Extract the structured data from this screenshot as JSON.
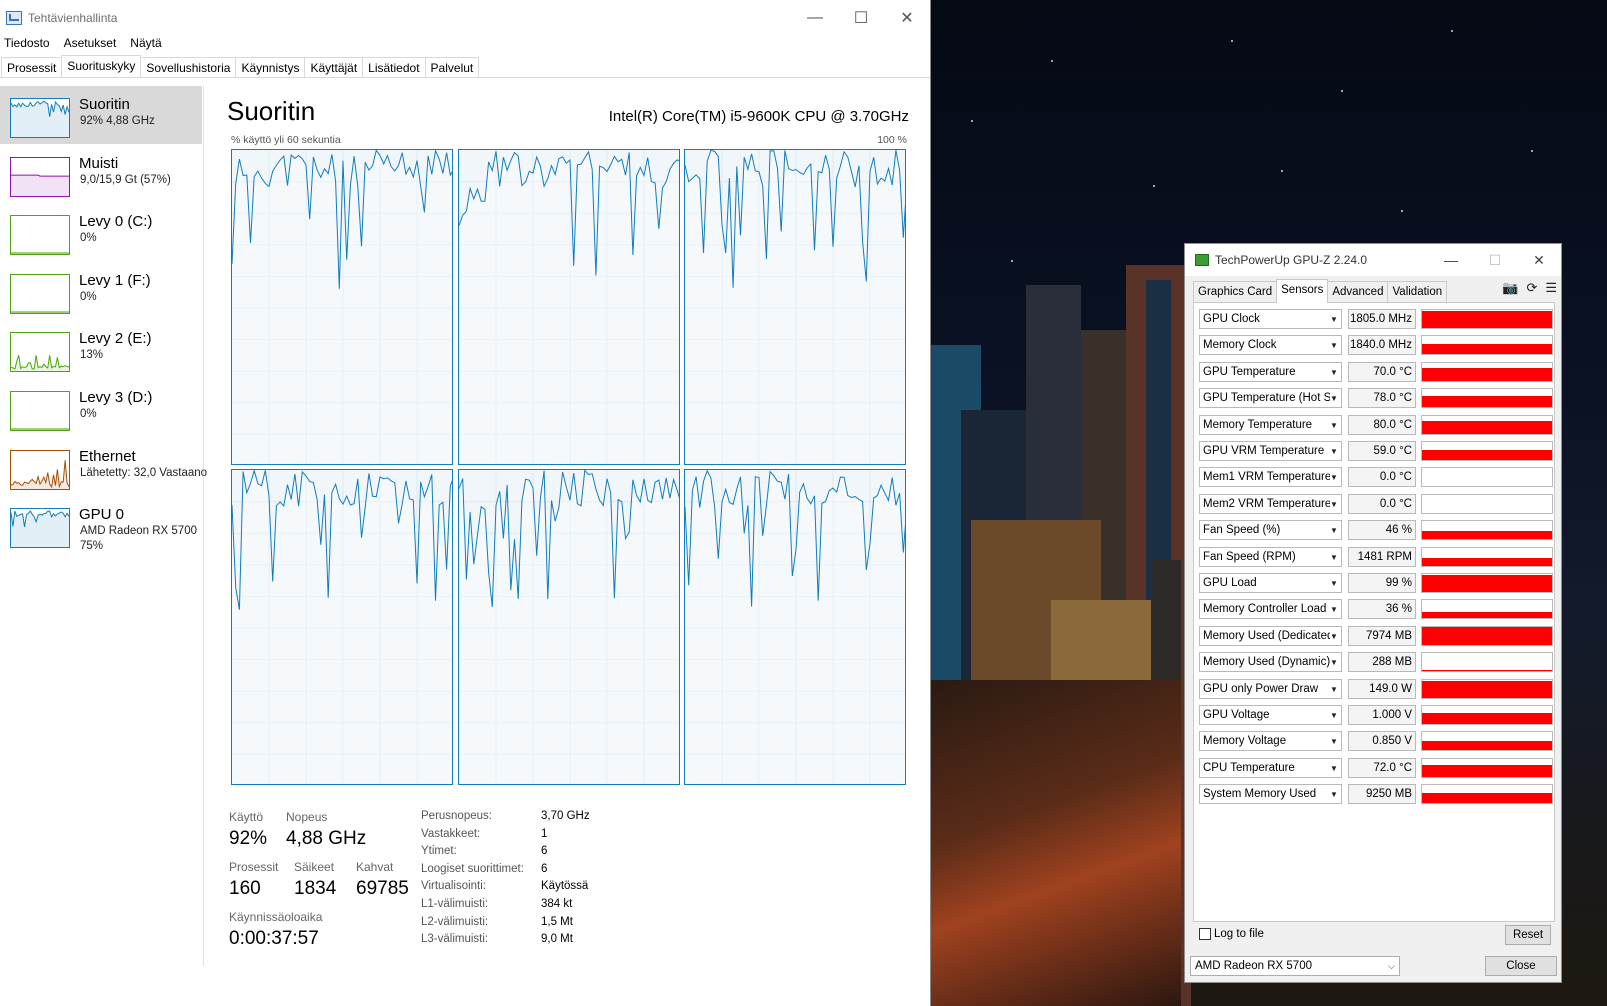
{
  "task_manager": {
    "title": "Tehtävienhallinta",
    "menu": [
      "Tiedosto",
      "Asetukset",
      "Näytä"
    ],
    "tabs": [
      "Prosessit",
      "Suorituskyky",
      "Sovellushistoria",
      "Käynnistys",
      "Käyttäjät",
      "Lisätiedot",
      "Palvelut"
    ],
    "active_tab": "Suorituskyky",
    "sidebar": [
      {
        "name": "Suoritin",
        "sub": "92% 4,88 GHz",
        "sub2": "",
        "color": "#117dbb"
      },
      {
        "name": "Muisti",
        "sub": "9,0/15,9 Gt (57%)",
        "sub2": "",
        "color": "#8b12ae"
      },
      {
        "name": "Levy 0 (C:)",
        "sub": "0%",
        "sub2": "",
        "color": "#4da60c"
      },
      {
        "name": "Levy 1 (F:)",
        "sub": "0%",
        "sub2": "",
        "color": "#4da60c"
      },
      {
        "name": "Levy 2 (E:)",
        "sub": "13%",
        "sub2": "",
        "color": "#4da60c"
      },
      {
        "name": "Levy 3 (D:)",
        "sub": "0%",
        "sub2": "",
        "color": "#4da60c"
      },
      {
        "name": "Ethernet",
        "sub": "Lähetetty: 32,0 Vastaano",
        "sub2": "",
        "color": "#a74f01"
      },
      {
        "name": "GPU 0",
        "sub": "AMD Radeon RX 5700",
        "sub2": "75%",
        "color": "#117dbb"
      }
    ],
    "main": {
      "title": "Suoritin",
      "cpu_model": "Intel(R) Core(TM) i5-9600K CPU @ 3.70GHz",
      "graph_caption": "% käyttö yli 60 sekuntia",
      "graph_max": "100 %",
      "stats": {
        "usage_label": "Käyttö",
        "usage": "92%",
        "speed_label": "Nopeus",
        "speed": "4,88 GHz",
        "processes_label": "Prosessit",
        "processes": "160",
        "threads_label": "Säikeet",
        "threads": "1834",
        "handles_label": "Kahvat",
        "handles": "69785",
        "uptime_label": "Käynnissäoloaika",
        "uptime": "0:00:37:57"
      },
      "properties": [
        {
          "label": "Perusnopeus:",
          "value": "3,70 GHz"
        },
        {
          "label": "Vastakkeet:",
          "value": "1"
        },
        {
          "label": "Ytimet:",
          "value": "6"
        },
        {
          "label": "Loogiset suorittimet:",
          "value": "6"
        },
        {
          "label": "Virtualisointi:",
          "value": "Käytössä"
        },
        {
          "label": "L1-välimuisti:",
          "value": "384 kt"
        },
        {
          "label": "L2-välimuisti:",
          "value": "1,5 Mt"
        },
        {
          "label": "L3-välimuisti:",
          "value": "9,0 Mt"
        }
      ]
    }
  },
  "gpuz": {
    "title": "TechPowerUp GPU-Z 2.24.0",
    "tabs": [
      "Graphics Card",
      "Sensors",
      "Advanced",
      "Validation"
    ],
    "active_tab": "Sensors",
    "sensors": [
      {
        "name": "GPU Clock",
        "value": "1805.0 MHz",
        "level": 0.95
      },
      {
        "name": "Memory Clock",
        "value": "1840.0 MHz",
        "level": 0.6
      },
      {
        "name": "GPU Temperature",
        "value": "70.0 °C",
        "level": 0.7
      },
      {
        "name": "GPU Temperature (Hot Spot)",
        "value": "78.0 °C",
        "level": 0.6
      },
      {
        "name": "Memory Temperature",
        "value": "80.0 °C",
        "level": 0.7
      },
      {
        "name": "GPU VRM Temperature",
        "value": "59.0 °C",
        "level": 0.55
      },
      {
        "name": "Mem1 VRM Temperature",
        "value": "0.0 °C",
        "level": 0.0
      },
      {
        "name": "Mem2 VRM Temperature",
        "value": "0.0 °C",
        "level": 0.0
      },
      {
        "name": "Fan Speed (%)",
        "value": "46 %",
        "level": 0.45
      },
      {
        "name": "Fan Speed (RPM)",
        "value": "1481 RPM",
        "level": 0.45
      },
      {
        "name": "GPU Load",
        "value": "99 %",
        "level": 0.95
      },
      {
        "name": "Memory Controller Load",
        "value": "36 %",
        "level": 0.35
      },
      {
        "name": "Memory Used (Dedicated)",
        "value": "7974 MB",
        "level": 0.97
      },
      {
        "name": "Memory Used (Dynamic)",
        "value": "288 MB",
        "level": 0.05
      },
      {
        "name": "GPU only Power Draw",
        "value": "149.0 W",
        "level": 0.9
      },
      {
        "name": "GPU Voltage",
        "value": "1.000 V",
        "level": 0.6
      },
      {
        "name": "Memory Voltage",
        "value": "0.850 V",
        "level": 0.5
      },
      {
        "name": "CPU Temperature",
        "value": "72.0 °C",
        "level": 0.65
      },
      {
        "name": "System Memory Used",
        "value": "9250 MB",
        "level": 0.55
      }
    ],
    "log_to_file": "Log to file",
    "reset": "Reset",
    "device": "AMD Radeon RX 5700",
    "close": "Close",
    "graph_color": "#ff0000"
  }
}
